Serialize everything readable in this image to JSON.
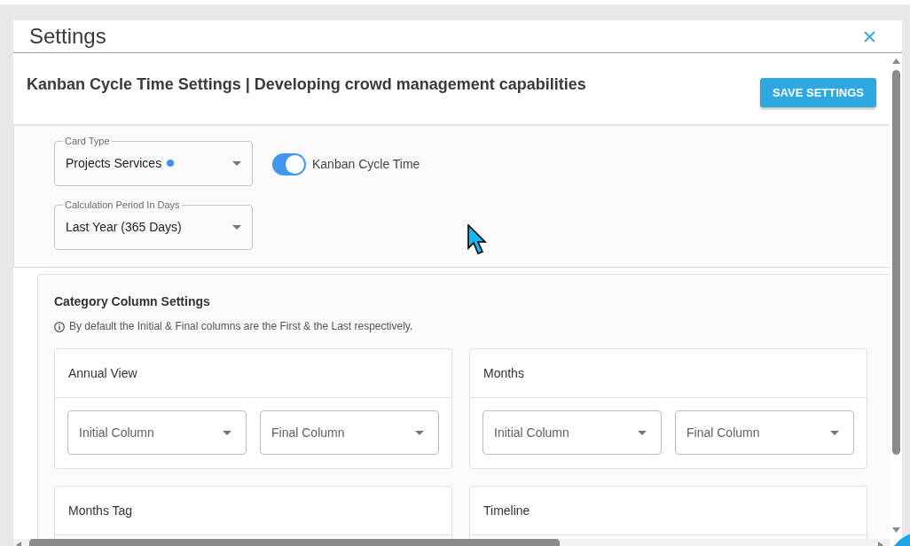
{
  "dialog": {
    "title": "Settings"
  },
  "header": {
    "title": "Kanban Cycle Time Settings | Developing crowd management capabilities",
    "save_button": "SAVE SETTINGS"
  },
  "filters": {
    "card_type": {
      "label": "Card Type",
      "value": "Projects Services"
    },
    "cycle_time_toggle": {
      "label": "Kanban Cycle Time",
      "on": true
    },
    "calculation_period": {
      "label": "Calculation Period In Days",
      "value": "Last Year (365 Days)"
    }
  },
  "category_settings": {
    "title": "Category Column Settings",
    "note": "By default the Initial & Final columns are the First & the Last respectively.",
    "views": [
      {
        "title": "Annual View",
        "selects": [
          {
            "placeholder": "Initial Column"
          },
          {
            "placeholder": "Final Column"
          }
        ]
      },
      {
        "title": "Months",
        "selects": [
          {
            "placeholder": "Initial Column"
          },
          {
            "placeholder": "Final Column"
          }
        ]
      },
      {
        "title": "Months Tag"
      },
      {
        "title": "Timeline"
      }
    ]
  }
}
